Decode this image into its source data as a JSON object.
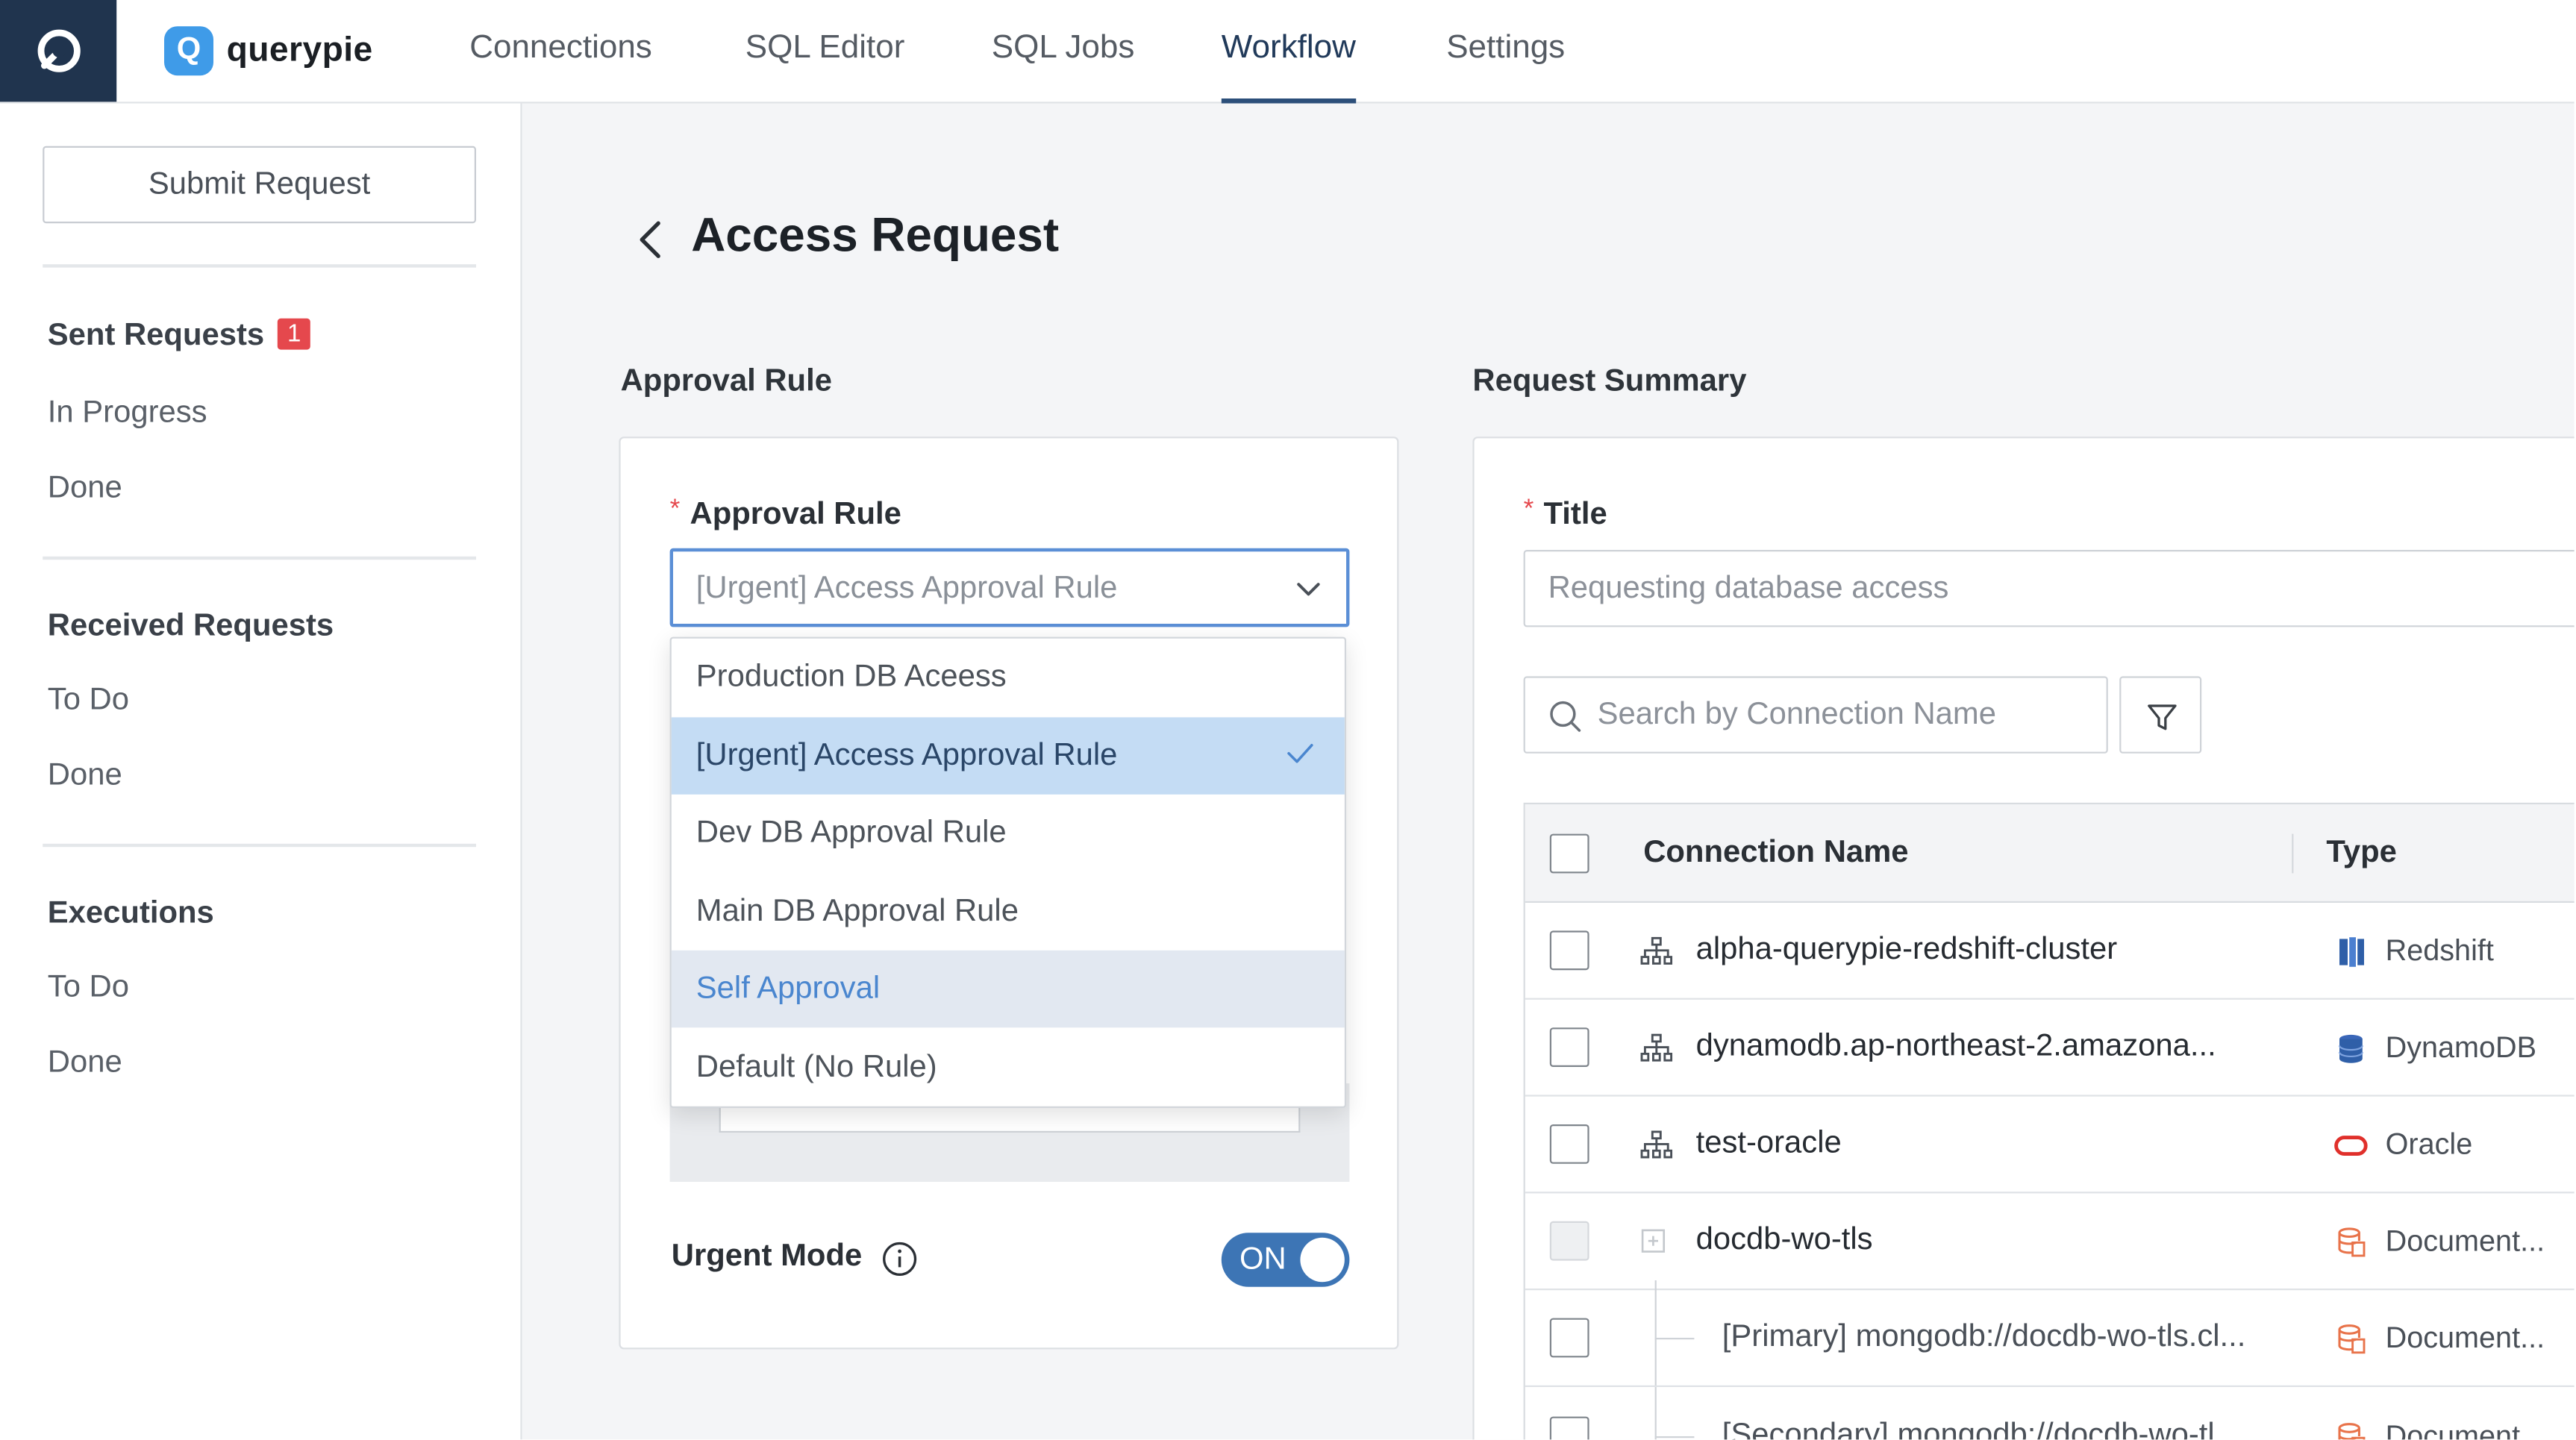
{
  "app": {
    "brand_letter": "Q",
    "brand_name": "querypie"
  },
  "nav": {
    "tabs": [
      {
        "label": "Connections",
        "active": false
      },
      {
        "label": "SQL Editor",
        "active": false
      },
      {
        "label": "SQL Jobs",
        "active": false
      },
      {
        "label": "Workflow",
        "active": true
      },
      {
        "label": "Settings",
        "active": false
      }
    ]
  },
  "sidebar": {
    "submit_label": "Submit Request",
    "sent": {
      "heading": "Sent Requests",
      "badge": "1",
      "items": [
        "In Progress",
        "Done"
      ]
    },
    "received": {
      "heading": "Received Requests",
      "items": [
        "To Do",
        "Done"
      ]
    },
    "executions": {
      "heading": "Executions",
      "items": [
        "To Do",
        "Done"
      ]
    }
  },
  "page": {
    "title": "Access Request"
  },
  "approval": {
    "section_label": "Approval Rule",
    "field_label": "Approval Rule",
    "required_mark": "*",
    "selected_value": "[Urgent] Access Approval Rule",
    "options": [
      {
        "label": "Production DB Aceess",
        "state": "normal"
      },
      {
        "label": "[Urgent] Access Approval Rule",
        "state": "selected"
      },
      {
        "label": "Dev DB Approval Rule",
        "state": "normal"
      },
      {
        "label": "Main DB Approval Rule",
        "state": "normal"
      },
      {
        "label": "Self Approval",
        "state": "hover"
      },
      {
        "label": "Default (No Rule)",
        "state": "normal"
      }
    ],
    "urgent_mode_label": "Urgent Mode",
    "urgent_toggle": "ON"
  },
  "summary": {
    "section_label": "Request Summary",
    "title_label": "Title",
    "required_mark": "*",
    "title_placeholder": "Requesting database access",
    "search_placeholder": "Search by Connection Name",
    "table": {
      "columns": [
        "Connection Name",
        "Type"
      ],
      "rows": [
        {
          "name": "alpha-querypie-redshift-cluster",
          "type": "Redshift",
          "type_icon": "redshift-icon",
          "child": false
        },
        {
          "name": "dynamodb.ap-northeast-2.amazona...",
          "type": "DynamoDB",
          "type_icon": "dynamodb-icon",
          "child": false
        },
        {
          "name": "test-oracle",
          "type": "Oracle",
          "type_icon": "oracle-icon",
          "child": false
        },
        {
          "name": "docdb-wo-tls",
          "type": "Document...",
          "type_icon": "documentdb-icon",
          "child": false
        },
        {
          "name": "[Primary] mongodb://docdb-wo-tls.cl...",
          "type": "Document...",
          "type_icon": "documentdb-icon",
          "child": true
        },
        {
          "name": "[Secondary] mongodb://docdb-wo-tl...",
          "type": "Document...",
          "type_icon": "documentdb-icon",
          "child": true
        }
      ]
    }
  },
  "colors": {
    "accent": "#3d75b5",
    "app_icon_bg": "#20344e",
    "badge": "#e5484d",
    "selected_option_bg": "#c4dcf4",
    "hover_option_bg": "#e2e8f1",
    "oracle": "#e0302b",
    "redshift": "#2f5fa8",
    "documentdb": "#e8734a"
  }
}
